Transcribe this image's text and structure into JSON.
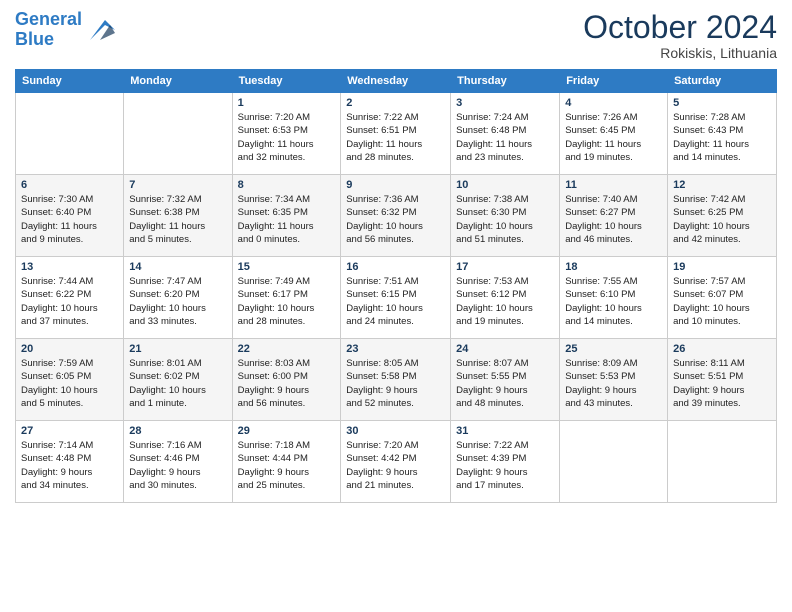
{
  "header": {
    "logo_line1": "General",
    "logo_line2": "Blue",
    "month": "October 2024",
    "location": "Rokiskis, Lithuania"
  },
  "weekdays": [
    "Sunday",
    "Monday",
    "Tuesday",
    "Wednesday",
    "Thursday",
    "Friday",
    "Saturday"
  ],
  "weeks": [
    [
      {
        "day": "",
        "content": ""
      },
      {
        "day": "",
        "content": ""
      },
      {
        "day": "1",
        "content": "Sunrise: 7:20 AM\nSunset: 6:53 PM\nDaylight: 11 hours\nand 32 minutes."
      },
      {
        "day": "2",
        "content": "Sunrise: 7:22 AM\nSunset: 6:51 PM\nDaylight: 11 hours\nand 28 minutes."
      },
      {
        "day": "3",
        "content": "Sunrise: 7:24 AM\nSunset: 6:48 PM\nDaylight: 11 hours\nand 23 minutes."
      },
      {
        "day": "4",
        "content": "Sunrise: 7:26 AM\nSunset: 6:45 PM\nDaylight: 11 hours\nand 19 minutes."
      },
      {
        "day": "5",
        "content": "Sunrise: 7:28 AM\nSunset: 6:43 PM\nDaylight: 11 hours\nand 14 minutes."
      }
    ],
    [
      {
        "day": "6",
        "content": "Sunrise: 7:30 AM\nSunset: 6:40 PM\nDaylight: 11 hours\nand 9 minutes."
      },
      {
        "day": "7",
        "content": "Sunrise: 7:32 AM\nSunset: 6:38 PM\nDaylight: 11 hours\nand 5 minutes."
      },
      {
        "day": "8",
        "content": "Sunrise: 7:34 AM\nSunset: 6:35 PM\nDaylight: 11 hours\nand 0 minutes."
      },
      {
        "day": "9",
        "content": "Sunrise: 7:36 AM\nSunset: 6:32 PM\nDaylight: 10 hours\nand 56 minutes."
      },
      {
        "day": "10",
        "content": "Sunrise: 7:38 AM\nSunset: 6:30 PM\nDaylight: 10 hours\nand 51 minutes."
      },
      {
        "day": "11",
        "content": "Sunrise: 7:40 AM\nSunset: 6:27 PM\nDaylight: 10 hours\nand 46 minutes."
      },
      {
        "day": "12",
        "content": "Sunrise: 7:42 AM\nSunset: 6:25 PM\nDaylight: 10 hours\nand 42 minutes."
      }
    ],
    [
      {
        "day": "13",
        "content": "Sunrise: 7:44 AM\nSunset: 6:22 PM\nDaylight: 10 hours\nand 37 minutes."
      },
      {
        "day": "14",
        "content": "Sunrise: 7:47 AM\nSunset: 6:20 PM\nDaylight: 10 hours\nand 33 minutes."
      },
      {
        "day": "15",
        "content": "Sunrise: 7:49 AM\nSunset: 6:17 PM\nDaylight: 10 hours\nand 28 minutes."
      },
      {
        "day": "16",
        "content": "Sunrise: 7:51 AM\nSunset: 6:15 PM\nDaylight: 10 hours\nand 24 minutes."
      },
      {
        "day": "17",
        "content": "Sunrise: 7:53 AM\nSunset: 6:12 PM\nDaylight: 10 hours\nand 19 minutes."
      },
      {
        "day": "18",
        "content": "Sunrise: 7:55 AM\nSunset: 6:10 PM\nDaylight: 10 hours\nand 14 minutes."
      },
      {
        "day": "19",
        "content": "Sunrise: 7:57 AM\nSunset: 6:07 PM\nDaylight: 10 hours\nand 10 minutes."
      }
    ],
    [
      {
        "day": "20",
        "content": "Sunrise: 7:59 AM\nSunset: 6:05 PM\nDaylight: 10 hours\nand 5 minutes."
      },
      {
        "day": "21",
        "content": "Sunrise: 8:01 AM\nSunset: 6:02 PM\nDaylight: 10 hours\nand 1 minute."
      },
      {
        "day": "22",
        "content": "Sunrise: 8:03 AM\nSunset: 6:00 PM\nDaylight: 9 hours\nand 56 minutes."
      },
      {
        "day": "23",
        "content": "Sunrise: 8:05 AM\nSunset: 5:58 PM\nDaylight: 9 hours\nand 52 minutes."
      },
      {
        "day": "24",
        "content": "Sunrise: 8:07 AM\nSunset: 5:55 PM\nDaylight: 9 hours\nand 48 minutes."
      },
      {
        "day": "25",
        "content": "Sunrise: 8:09 AM\nSunset: 5:53 PM\nDaylight: 9 hours\nand 43 minutes."
      },
      {
        "day": "26",
        "content": "Sunrise: 8:11 AM\nSunset: 5:51 PM\nDaylight: 9 hours\nand 39 minutes."
      }
    ],
    [
      {
        "day": "27",
        "content": "Sunrise: 7:14 AM\nSunset: 4:48 PM\nDaylight: 9 hours\nand 34 minutes."
      },
      {
        "day": "28",
        "content": "Sunrise: 7:16 AM\nSunset: 4:46 PM\nDaylight: 9 hours\nand 30 minutes."
      },
      {
        "day": "29",
        "content": "Sunrise: 7:18 AM\nSunset: 4:44 PM\nDaylight: 9 hours\nand 25 minutes."
      },
      {
        "day": "30",
        "content": "Sunrise: 7:20 AM\nSunset: 4:42 PM\nDaylight: 9 hours\nand 21 minutes."
      },
      {
        "day": "31",
        "content": "Sunrise: 7:22 AM\nSunset: 4:39 PM\nDaylight: 9 hours\nand 17 minutes."
      },
      {
        "day": "",
        "content": ""
      },
      {
        "day": "",
        "content": ""
      }
    ]
  ]
}
